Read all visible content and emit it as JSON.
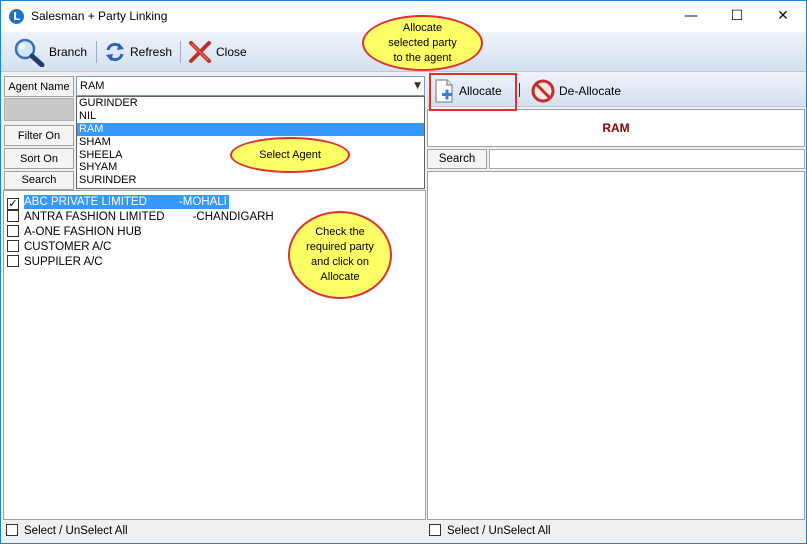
{
  "window": {
    "title": "Salesman + Party Linking",
    "minimize_glyph": "—",
    "maximize_glyph": "☐",
    "close_glyph": "✕"
  },
  "toolbar": {
    "branch_label": "Branch",
    "refresh_label": "Refresh",
    "close_label": "Close"
  },
  "left": {
    "agent_name_label": "Agent Name",
    "agent_selected": "RAM",
    "filter_on_label": "Filter On",
    "sort_on_label": "Sort On",
    "search_label": "Search",
    "agent_options": [
      "GURINDER",
      "NIL",
      "RAM",
      "SHAM",
      "SHEELA",
      "SHYAM",
      "SURINDER"
    ],
    "parties": [
      {
        "name": "ABC PRIVATE LIMITED",
        "city": "-MOHALI",
        "checked": true
      },
      {
        "name": "ANTRA FASHION LIMITED",
        "city": "-CHANDIGARH",
        "checked": false
      },
      {
        "name": "A-ONE FASHION HUB",
        "city": "",
        "checked": false
      },
      {
        "name": "CUSTOMER A/C",
        "city": "",
        "checked": false
      },
      {
        "name": "SUPPILER A/C",
        "city": "",
        "checked": false
      }
    ],
    "select_all_label": "Select / UnSelect All"
  },
  "right": {
    "allocate_label": "Allocate",
    "deallocate_label": "De-Allocate",
    "agent_heading": "RAM",
    "search_label": "Search",
    "select_all_label": "Select / UnSelect All"
  },
  "callouts": {
    "allocate": "Allocate\nselected  party\nto  the  agent",
    "select_agent": "Select   Agent",
    "check_party": "Check  the\nrequired  party\nand  click  on\nAllocate"
  },
  "colors": {
    "selection": "#3399ff",
    "agent_heading": "#8b0000",
    "callout_fill": "#ffff66",
    "callout_border": "#e03030"
  }
}
